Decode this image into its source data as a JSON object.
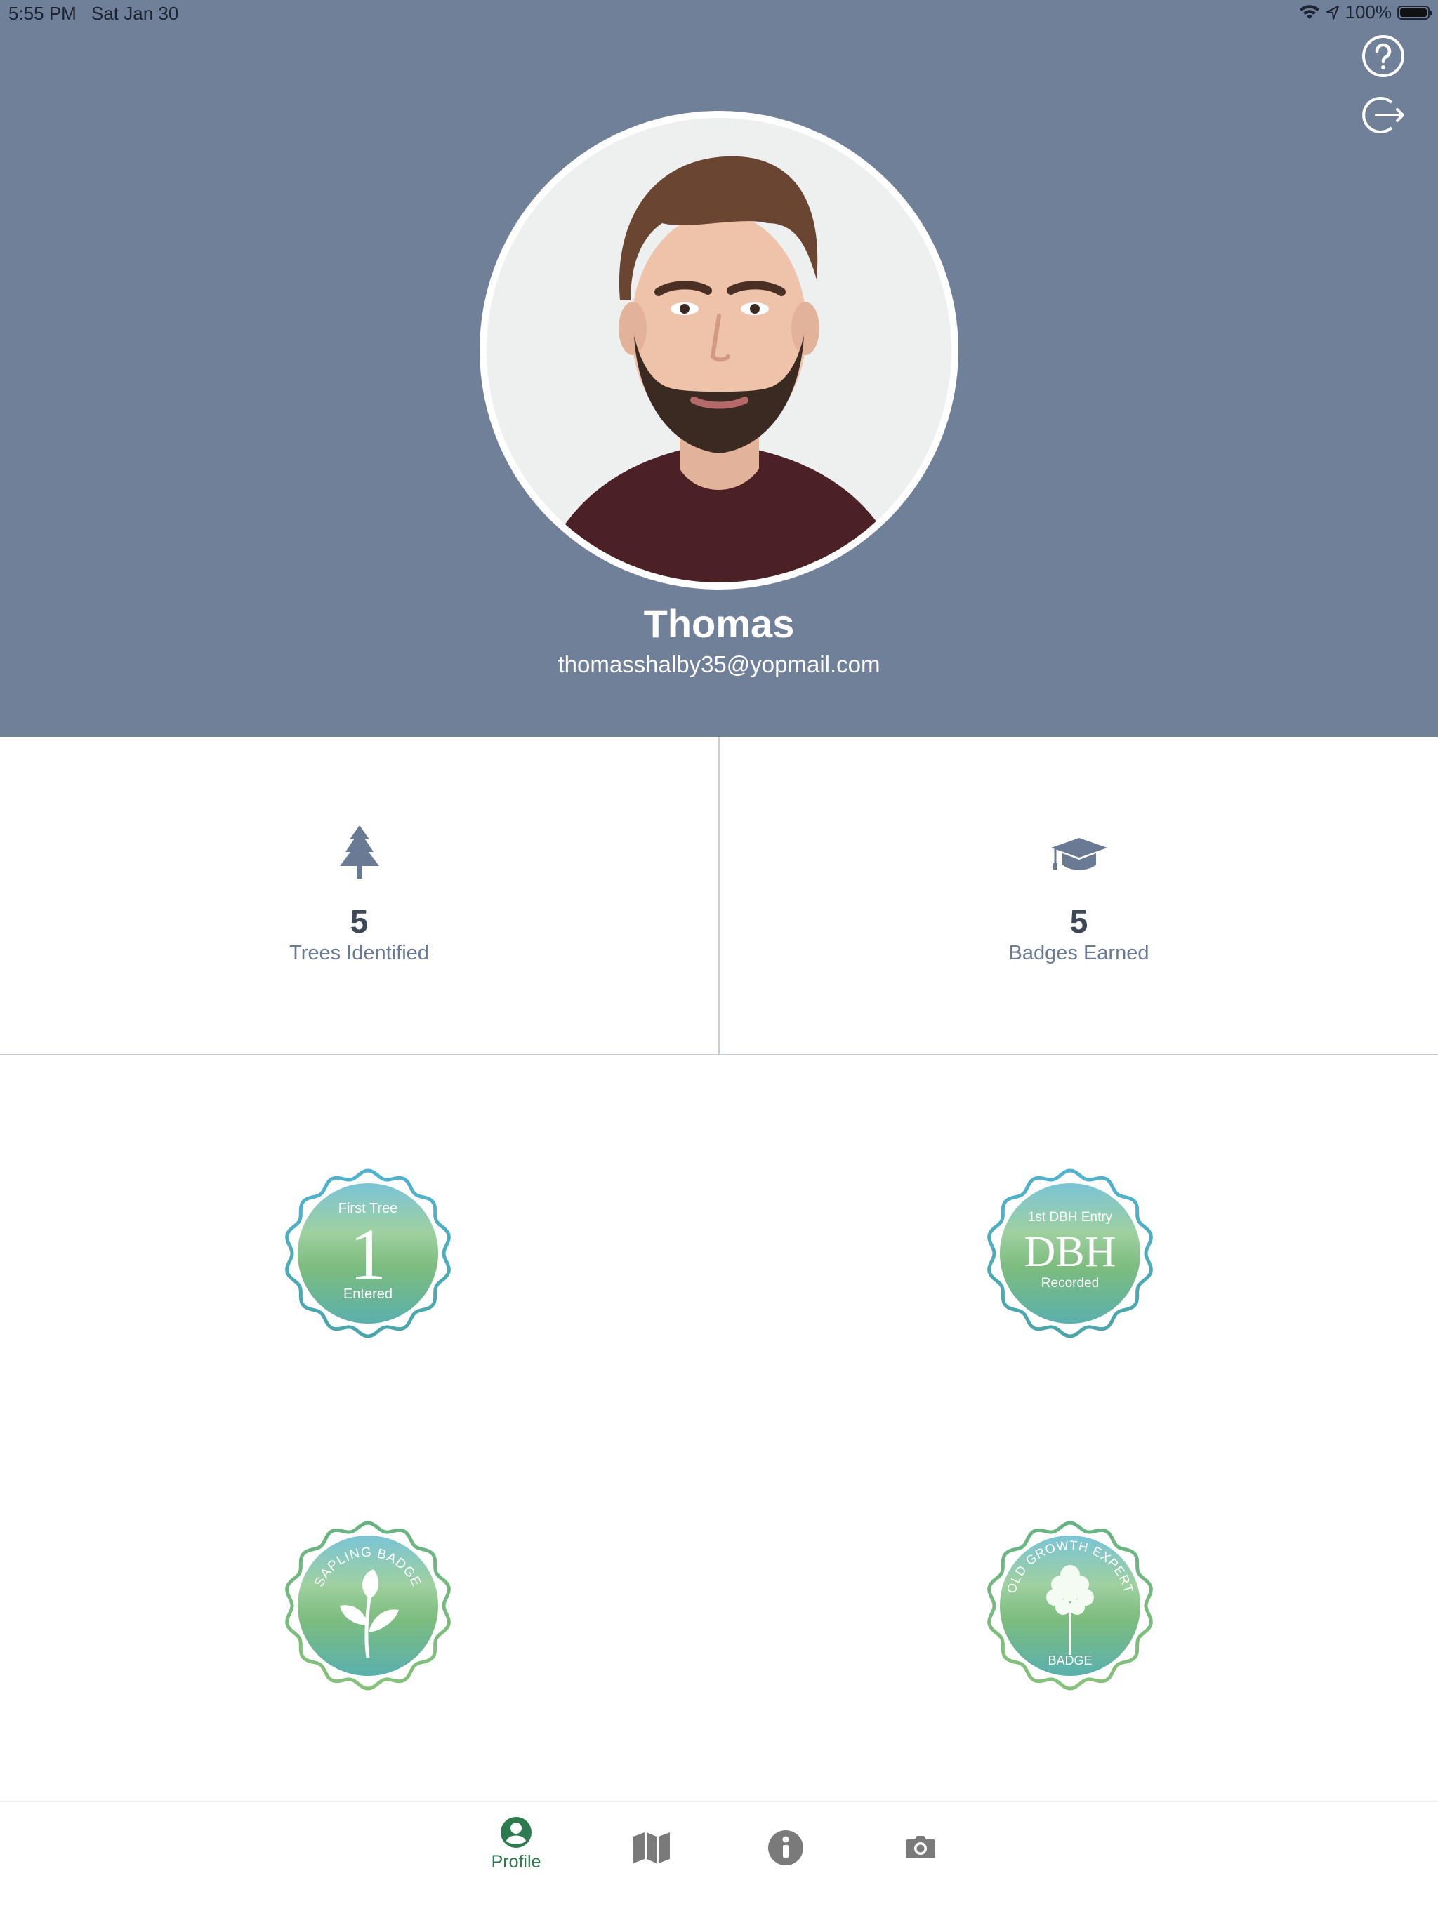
{
  "status_bar": {
    "time": "5:55 PM",
    "date": "Sat Jan 30",
    "battery": "100%"
  },
  "header": {
    "background_color": "#718099",
    "help_icon": "question-circle-icon",
    "logout_icon": "logout-icon"
  },
  "profile": {
    "name": "Thomas",
    "email": "thomasshalby35@yopmail.com"
  },
  "stats": [
    {
      "icon": "tree-icon",
      "value": "5",
      "label": "Trees Identified"
    },
    {
      "icon": "graduation-cap-icon",
      "value": "5",
      "label": "Badges Earned"
    }
  ],
  "badges": [
    {
      "top_text": "First Tree",
      "center_text": "1",
      "bottom_text": "Entered"
    },
    {
      "top_text": "1st DBH Entry",
      "center_text": "DBH",
      "bottom_text": "Recorded"
    },
    {
      "arc_text": "SAPLING BADGE",
      "icon": "sapling-icon"
    },
    {
      "arc_text": "OLD GROWTH EXPERT",
      "bottom_text": "BADGE",
      "icon": "tree-icon"
    }
  ],
  "tabs": [
    {
      "icon": "profile-icon",
      "label": "Profile",
      "active": true
    },
    {
      "icon": "map-icon",
      "active": false
    },
    {
      "icon": "info-icon",
      "active": false
    },
    {
      "icon": "camera-icon",
      "active": false
    }
  ],
  "colors": {
    "accent_green": "#2e7a4f",
    "stat_icon": "#6a7a94",
    "tab_inactive": "#7a7a7a"
  }
}
